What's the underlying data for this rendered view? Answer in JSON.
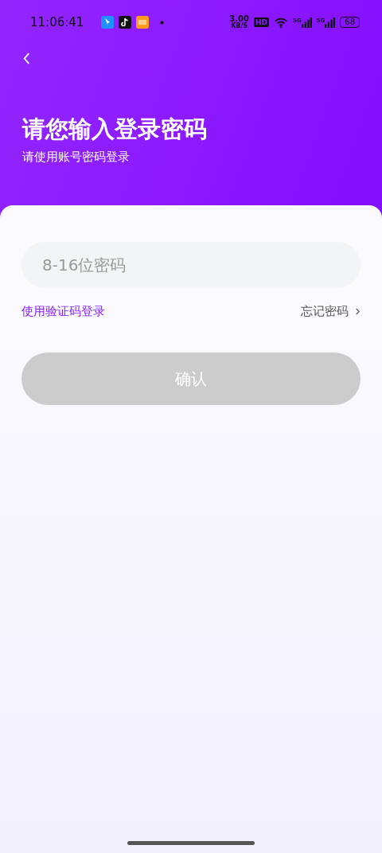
{
  "status_bar": {
    "time": "11:06:41",
    "speed": "3.00",
    "speed_unit": "KB/S",
    "hd": "HD",
    "signals": [
      "5G",
      "5G"
    ],
    "battery": "68"
  },
  "header": {
    "title": "请您输入登录密码",
    "subtitle": "请使用账号密码登录"
  },
  "password_field": {
    "placeholder": "8-16位密码"
  },
  "links": {
    "sms_login": "使用验证码登录",
    "forgot": "忘记密码"
  },
  "confirm_button": {
    "label": "确认",
    "disabled": true
  }
}
